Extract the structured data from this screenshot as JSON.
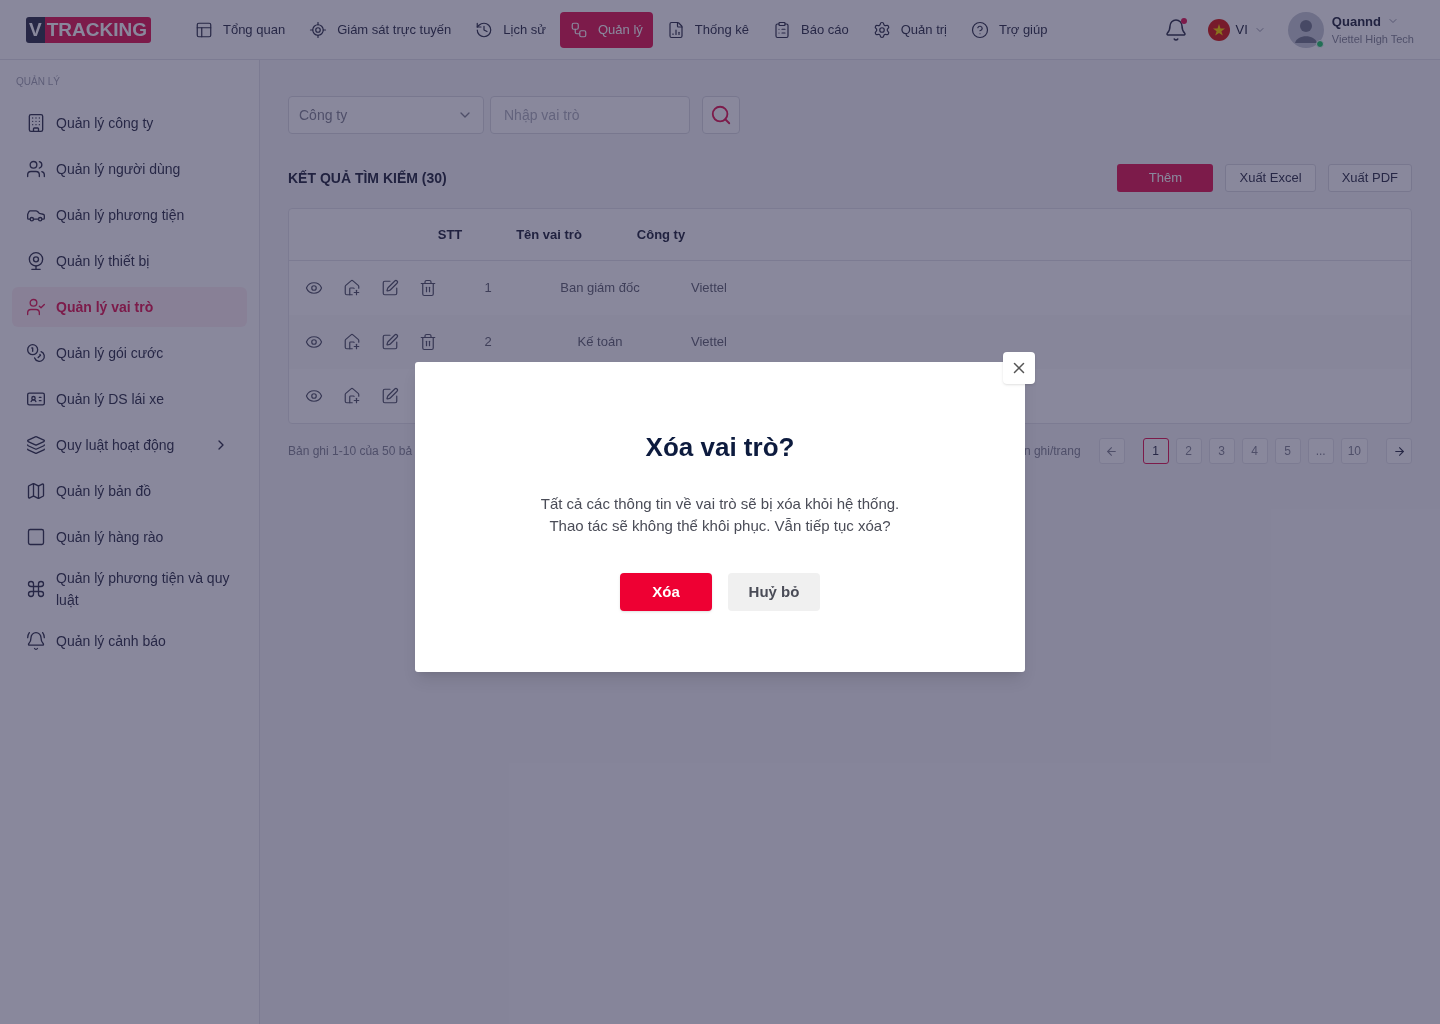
{
  "header": {
    "logo": {
      "prefix": "V",
      "text": "TRACKING"
    },
    "nav": [
      {
        "label": "Tổng quan",
        "selected": false
      },
      {
        "label": "Giám sát trực tuyến",
        "selected": false
      },
      {
        "label": "Lịch sử",
        "selected": false
      },
      {
        "label": "Quản lý",
        "selected": true
      },
      {
        "label": "Thống kê",
        "selected": false
      },
      {
        "label": "Báo cáo",
        "selected": false
      },
      {
        "label": "Quản trị",
        "selected": false
      },
      {
        "label": "Trợ giúp",
        "selected": false
      }
    ],
    "notifications": {
      "unread": true
    },
    "language": "VI",
    "user": {
      "name": "Quannd",
      "company": "Viettel High Tech",
      "online": true
    }
  },
  "sidebar": {
    "section": "QUẢN LÝ",
    "items": [
      {
        "label": "Quản lý công ty",
        "selected": false,
        "has_submenu": false
      },
      {
        "label": "Quản lý người dùng",
        "selected": false,
        "has_submenu": false
      },
      {
        "label": "Quản lý phương tiện",
        "selected": false,
        "has_submenu": false
      },
      {
        "label": "Quản lý thiết bị",
        "selected": false,
        "has_submenu": false
      },
      {
        "label": "Quản lý vai trò",
        "selected": true,
        "has_submenu": false
      },
      {
        "label": "Quản lý gói cước",
        "selected": false,
        "has_submenu": false
      },
      {
        "label": "Quản lý DS lái xe",
        "selected": false,
        "has_submenu": false
      },
      {
        "label": "Quy luật hoạt động",
        "selected": false,
        "has_submenu": true
      },
      {
        "label": "Quản lý bản đồ",
        "selected": false,
        "has_submenu": false
      },
      {
        "label": "Quản lý hàng rào",
        "selected": false,
        "has_submenu": false
      },
      {
        "label": "Quản lý phương tiện và quy luật",
        "selected": false,
        "has_submenu": false
      },
      {
        "label": "Quản lý cảnh báo",
        "selected": false,
        "has_submenu": false
      }
    ]
  },
  "filters": {
    "company_select": {
      "placeholder": "Công ty"
    },
    "role_search": {
      "placeholder": "Nhập vai trò"
    }
  },
  "results": {
    "title": "KẾT QUẢ TÌM KIẾM (30)",
    "buttons": [
      {
        "label": "Thêm",
        "kind": "primary"
      },
      {
        "label": "Xuất Excel",
        "kind": "outline"
      },
      {
        "label": "Xuất PDF",
        "kind": "outline"
      }
    ]
  },
  "table": {
    "columns": [
      "STT",
      "Tên vai trò",
      "Công ty"
    ],
    "rows": [
      {
        "actions": [
          {
            "kind": "view"
          },
          {
            "kind": "home"
          },
          {
            "kind": "edit"
          },
          {
            "kind": "delete"
          }
        ],
        "cells": [
          "1",
          "Ban giám đốc",
          "Viettel"
        ]
      },
      {
        "actions": [
          {
            "kind": "view"
          },
          {
            "kind": "home"
          },
          {
            "kind": "edit"
          },
          {
            "kind": "delete"
          }
        ],
        "cells": [
          "2",
          "Kế toán",
          "Viettel"
        ]
      },
      {
        "actions": [
          {
            "kind": "view"
          },
          {
            "kind": "home"
          },
          {
            "kind": "edit"
          }
        ],
        "cells": []
      }
    ]
  },
  "pagination": {
    "summary": "Bản ghi 1-10 của 50 bả",
    "page_size_label": "n ghi/trang",
    "pages": [
      {
        "label": "1",
        "selected": true
      },
      {
        "label": "2",
        "selected": false
      },
      {
        "label": "3",
        "selected": false
      },
      {
        "label": "4",
        "selected": false
      },
      {
        "label": "5",
        "selected": false
      },
      {
        "label": "...",
        "selected": false
      },
      {
        "label": "10",
        "selected": false
      }
    ]
  },
  "dialog": {
    "title": "Xóa vai trò?",
    "message": [
      "Tất cả các thông tin về vai trò sẽ bị xóa khỏi hệ thống.",
      "Thao tác sẽ không thể khôi phục. Vẫn tiếp tục xóa?"
    ],
    "buttons": [
      {
        "label": "Xóa",
        "kind": "danger"
      },
      {
        "label": "Huỷ bỏ",
        "kind": "secondary"
      }
    ]
  }
}
